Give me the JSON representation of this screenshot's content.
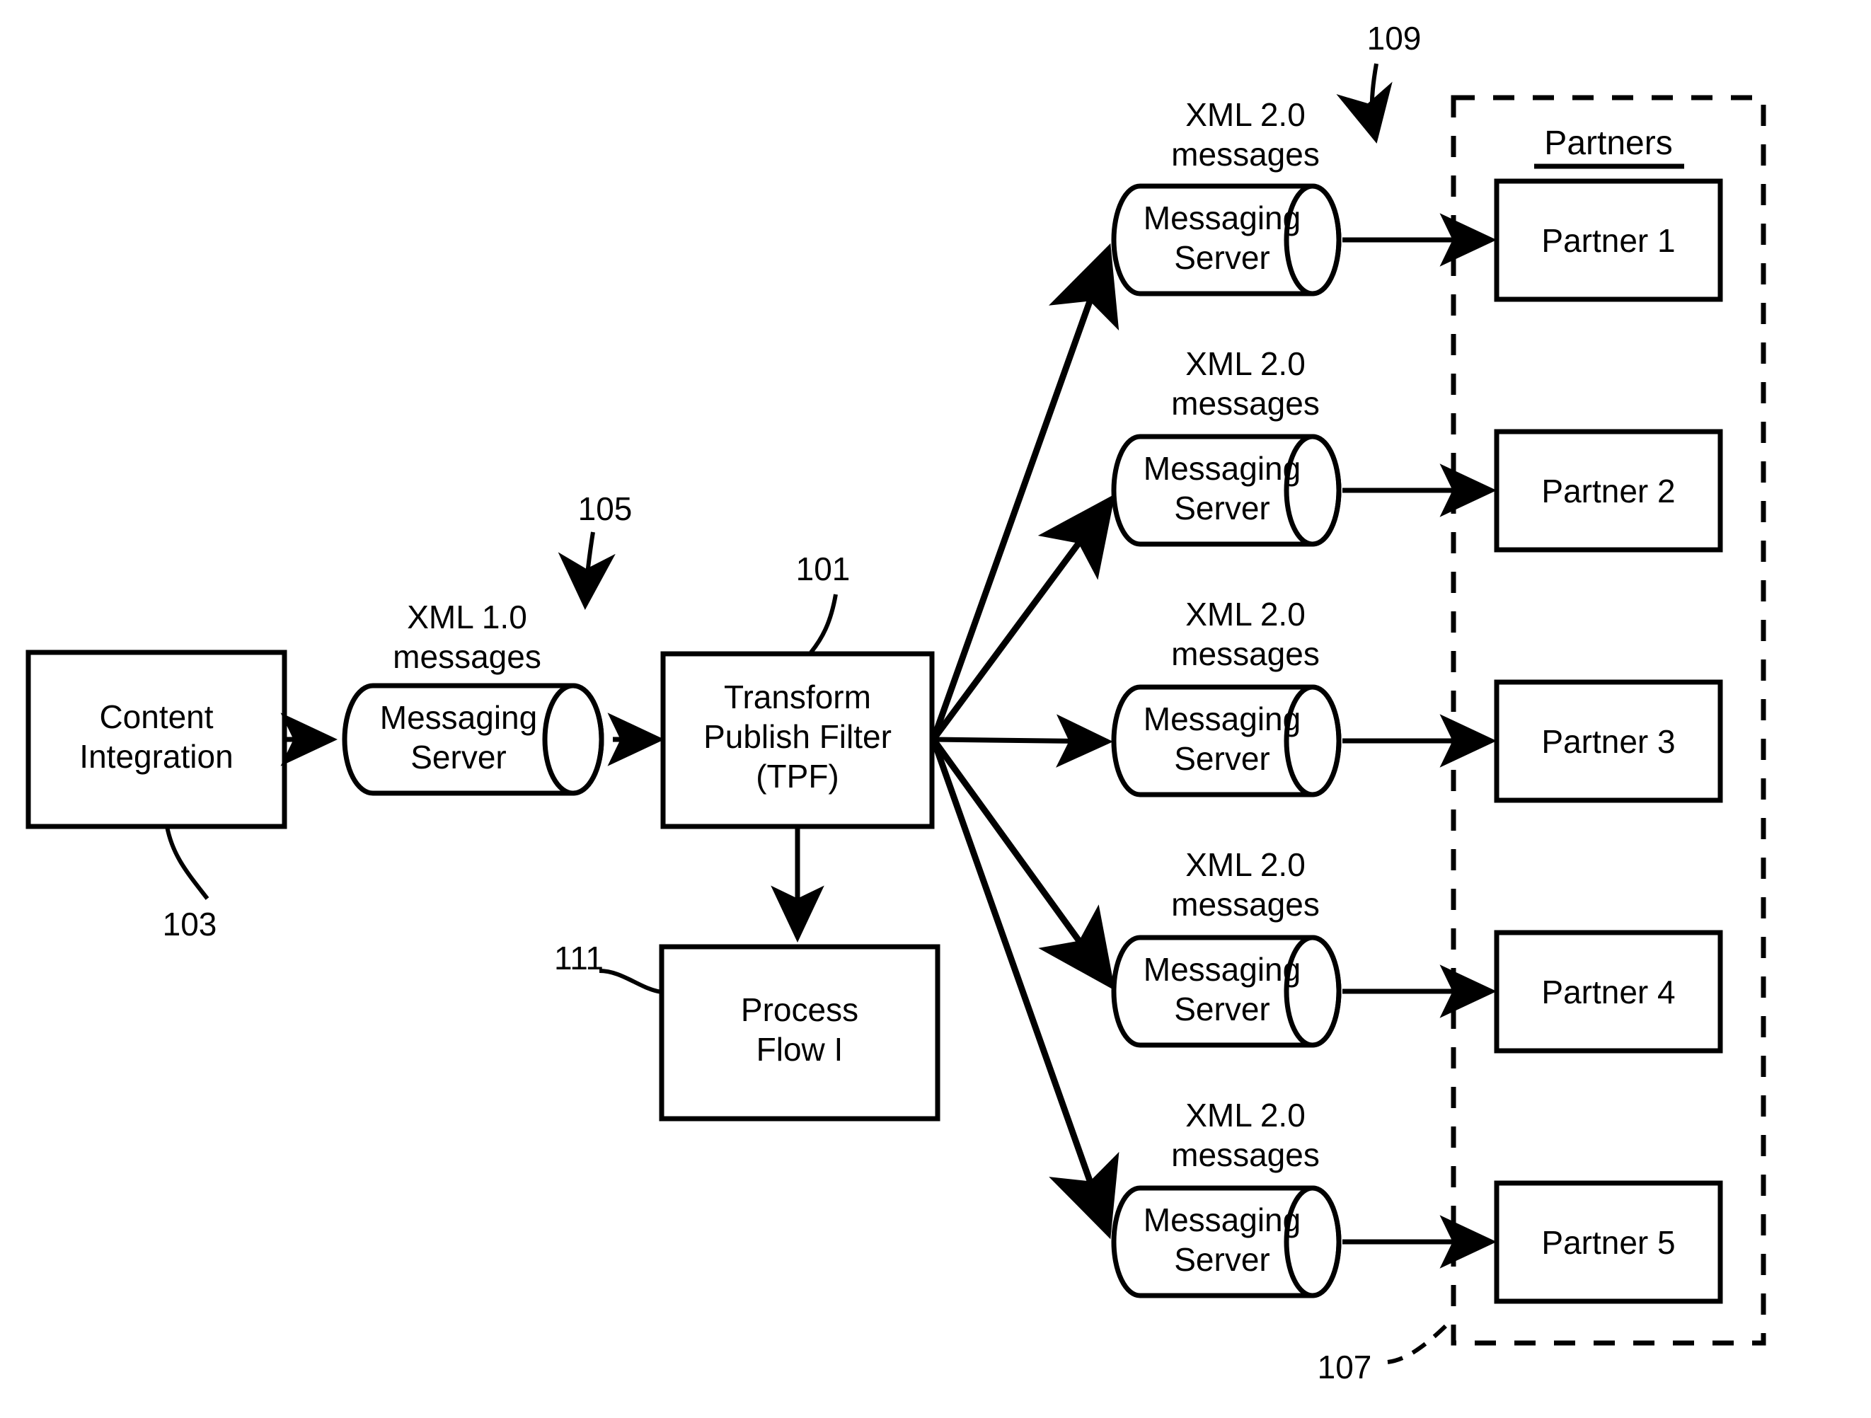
{
  "figure": {
    "title": "Transform Publish Filter message distribution architecture",
    "background_color": "#ffffff",
    "line_color": "#000000"
  },
  "nodes": {
    "content_integration": {
      "line1": "Content",
      "line2": "Integration",
      "ref": "103",
      "shape": "rectangle"
    },
    "inbound_messaging_server": {
      "line1": "Messaging",
      "line2": "Server",
      "shape": "cylinder"
    },
    "inbound_message_label": {
      "line1": "XML 1.0",
      "line2": "messages",
      "ref": "105"
    },
    "tpf": {
      "line1": "Transform",
      "line2": "Publish Filter",
      "line3": "(TPF)",
      "ref": "101",
      "shape": "rectangle"
    },
    "process_flow": {
      "line1": "Process",
      "line2": "Flow I",
      "ref": "111",
      "shape": "rectangle"
    }
  },
  "outbound": {
    "ref": "109",
    "message_label": {
      "line1": "XML 2.0",
      "line2": "messages"
    },
    "server_label": {
      "line1": "Messaging",
      "line2": "Server"
    },
    "branches": [
      {
        "index": 1,
        "partner": "Partner 1",
        "message_line1": "XML 2.0",
        "message_line2": "messages",
        "server_line1": "Messaging",
        "server_line2": "Server"
      },
      {
        "index": 2,
        "partner": "Partner 2",
        "message_line1": "XML 2.0",
        "message_line2": "messages",
        "server_line1": "Messaging",
        "server_line2": "Server"
      },
      {
        "index": 3,
        "partner": "Partner 3",
        "message_line1": "XML 2.0",
        "message_line2": "messages",
        "server_line1": "Messaging",
        "server_line2": "Server"
      },
      {
        "index": 4,
        "partner": "Partner 4",
        "message_line1": "XML 2.0",
        "message_line2": "messages",
        "server_line1": "Messaging",
        "server_line2": "Server"
      },
      {
        "index": 5,
        "partner": "Partner 5",
        "message_line1": "XML 2.0",
        "message_line2": "messages",
        "server_line1": "Messaging",
        "server_line2": "Server"
      }
    ]
  },
  "partners_group": {
    "title": "Partners",
    "ref": "107",
    "border_style": "dashed"
  },
  "reference_numerals": {
    "tpf": "101",
    "content_integration": "103",
    "inbound_messages": "105",
    "partners_boundary": "107",
    "outbound_messages": "109",
    "process_flow": "111"
  }
}
